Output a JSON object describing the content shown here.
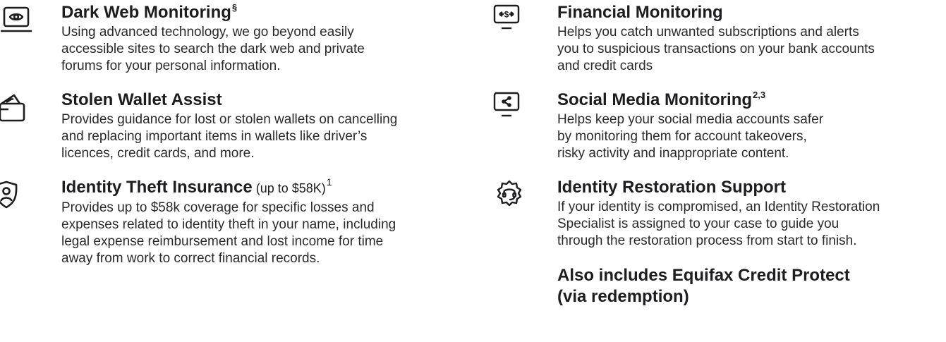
{
  "left_features": [
    {
      "icon": "monitor-eye-icon",
      "title": "Dark Web Monitoring",
      "title_sup": "§",
      "desc_lines": [
        "Using advanced technology, we go beyond easily",
        "accessible sites to search the dark web and private",
        "forums for your personal information."
      ]
    },
    {
      "icon": "wallet-card-icon",
      "title": "Stolen Wallet Assist",
      "desc_lines": [
        "Provides guidance for lost or stolen wallets on cancelling",
        "and replacing important items in wallets like driver’s",
        "licences, credit cards, and more."
      ]
    },
    {
      "icon": "identity-shield-icon",
      "title": "Identity Theft Insurance",
      "title_suffix": " (up to $58K)",
      "title_sup": "1",
      "desc_lines": [
        "Provides up to $58k coverage for specific losses and",
        "expenses related to identity theft in your name, including",
        "legal expense reimbursement and lost income for time",
        "away from work to correct financial records."
      ]
    }
  ],
  "right_features": [
    {
      "icon": "monitor-dollar-icon",
      "title": "Financial Monitoring",
      "desc_lines": [
        "Helps you catch unwanted subscriptions and alerts",
        "you to suspicious transactions on your bank accounts",
        "and credit cards"
      ]
    },
    {
      "icon": "monitor-share-icon",
      "title": "Social Media Monitoring",
      "title_sup": "2,3",
      "desc_lines": [
        "Helps keep your social media accounts safer",
        "by monitoring them for account takeovers,",
        "risky activity and inappropriate content."
      ]
    },
    {
      "icon": "support-headset-icon",
      "title": "Identity Restoration Support",
      "desc_lines": [
        "If your identity is compromised, an Identity Restoration",
        "Specialist is assigned to your case to guide you",
        "through the restoration process from start to finish."
      ]
    }
  ],
  "also_includes_lines": [
    "Also includes Equifax Credit Protect",
    "(via redemption)"
  ]
}
